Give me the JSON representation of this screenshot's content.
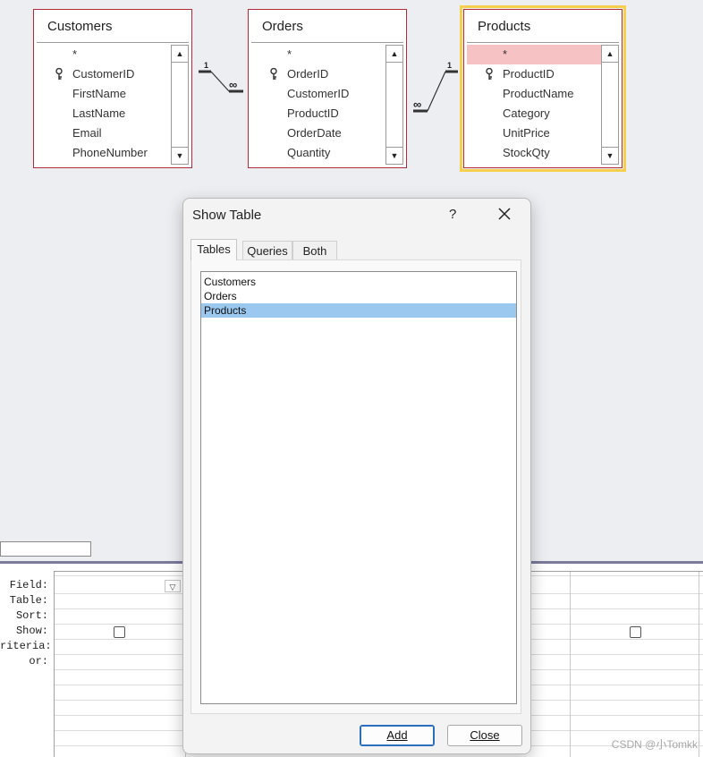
{
  "tables": [
    {
      "name": "Customers",
      "fields": [
        "*",
        "CustomerID",
        "FirstName",
        "LastName",
        "Email",
        "PhoneNumber"
      ],
      "key_field": "CustomerID",
      "selected": false
    },
    {
      "name": "Orders",
      "fields": [
        "*",
        "OrderID",
        "CustomerID",
        "ProductID",
        "OrderDate",
        "Quantity"
      ],
      "key_field": "OrderID",
      "selected": false
    },
    {
      "name": "Products",
      "fields": [
        "*",
        "ProductID",
        "ProductName",
        "Category",
        "UnitPrice",
        "StockQty"
      ],
      "key_field": "ProductID",
      "selected": true
    }
  ],
  "relationships": [
    {
      "one": "1",
      "many": "∞"
    },
    {
      "one": "1",
      "many": "∞"
    }
  ],
  "grid": {
    "row_labels": [
      "Field:",
      "Table:",
      "Sort:",
      "Show:",
      "riteria:",
      "or:"
    ]
  },
  "dialog": {
    "title": "Show Table",
    "help": "?",
    "tabs": [
      "Tables",
      "Queries",
      "Both"
    ],
    "active_tab": "Tables",
    "items": [
      "Customers",
      "Orders",
      "Products"
    ],
    "selected_item": "Products",
    "add_label": "Add",
    "close_label": "Close"
  },
  "watermark": "CSDN @小Tomkk",
  "colors": {
    "table_border": "#b22d3a",
    "selection_outline": "#f6cf4d",
    "list_selection": "#9ac8ef",
    "highlight_row": "#f7c2c4"
  }
}
